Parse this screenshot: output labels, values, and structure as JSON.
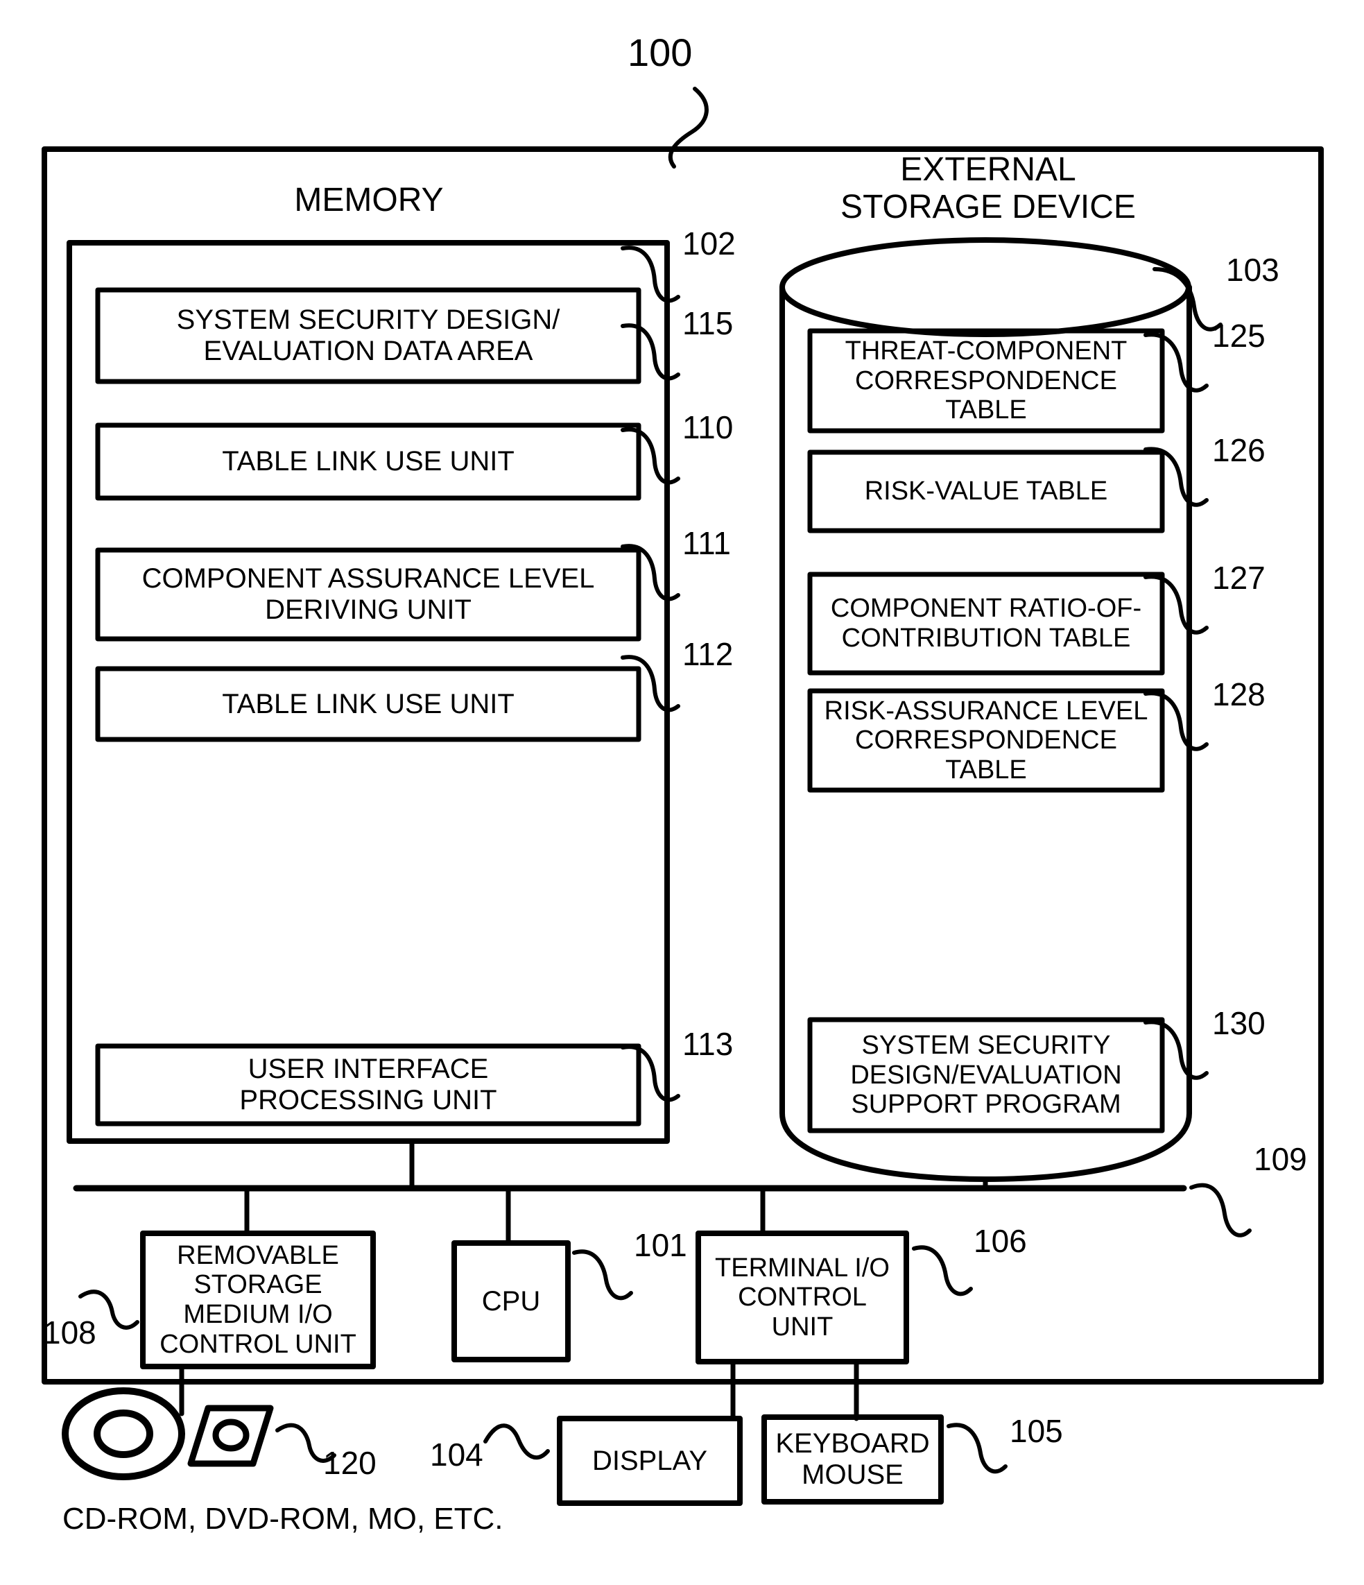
{
  "figure": {
    "top_reference": "100",
    "memory_title": "MEMORY",
    "storage_title": "EXTERNAL\nSTORAGE DEVICE",
    "media_caption": "CD-ROM, DVD-ROM, MO, ETC."
  },
  "memory": {
    "reference": "102",
    "blocks": [
      {
        "label": "SYSTEM SECURITY DESIGN/\nEVALUATION DATA AREA",
        "reference": "115"
      },
      {
        "label": "TABLE LINK USE UNIT",
        "reference": "110"
      },
      {
        "label": "COMPONENT ASSURANCE LEVEL\nDERIVING UNIT",
        "reference": "111"
      },
      {
        "label": "TABLE LINK USE UNIT",
        "reference": "112"
      },
      {
        "label": "USER INTERFACE\nPROCESSING UNIT",
        "reference": "113"
      }
    ]
  },
  "external_storage": {
    "reference": "103",
    "blocks": [
      {
        "label": "THREAT-COMPONENT\nCORRESPONDENCE\nTABLE",
        "reference": "125"
      },
      {
        "label": "RISK-VALUE TABLE",
        "reference": "126"
      },
      {
        "label": "COMPONENT RATIO-OF-\nCONTRIBUTION TABLE",
        "reference": "127"
      },
      {
        "label": "RISK-ASSURANCE LEVEL\nCORRESPONDENCE\nTABLE",
        "reference": "128"
      },
      {
        "label": "SYSTEM SECURITY\nDESIGN/EVALUATION\nSUPPORT PROGRAM",
        "reference": "130"
      }
    ]
  },
  "bus": {
    "reference": "109"
  },
  "peripherals": [
    {
      "label": "REMOVABLE\nSTORAGE\nMEDIUM I/O\nCONTROL UNIT",
      "reference": "108"
    },
    {
      "label": "CPU",
      "reference": "101"
    },
    {
      "label": "TERMINAL I/O\nCONTROL\nUNIT",
      "reference": "106"
    },
    {
      "label": "DISPLAY",
      "reference": "104"
    },
    {
      "label": "KEYBOARD\nMOUSE",
      "reference": "105"
    }
  ],
  "media": {
    "reference": "120",
    "icon_disc": "optical-disc-icon",
    "icon_floppy": "floppy-disk-icon"
  },
  "colors": {
    "line": "#000000",
    "background": "#ffffff"
  }
}
